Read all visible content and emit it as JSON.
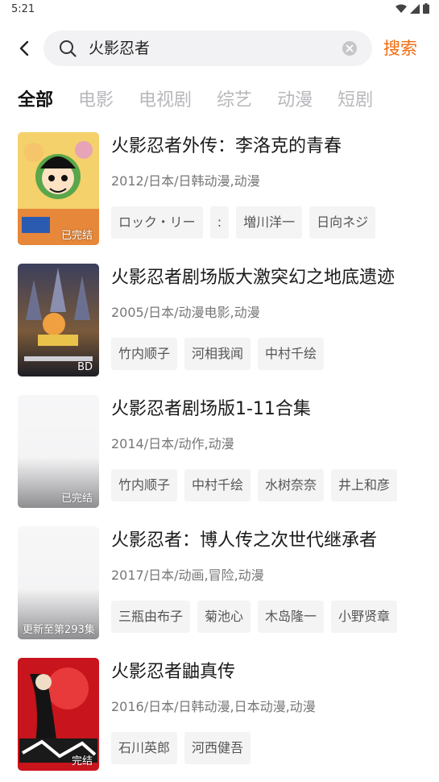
{
  "status": {
    "time": "5:21"
  },
  "search": {
    "query": "火影忍者",
    "button_label": "搜索"
  },
  "tabs": [
    {
      "label": "全部",
      "active": true
    },
    {
      "label": "电影",
      "active": false
    },
    {
      "label": "电视剧",
      "active": false
    },
    {
      "label": "综艺",
      "active": false
    },
    {
      "label": "动漫",
      "active": false
    },
    {
      "label": "短剧",
      "active": false
    }
  ],
  "results": [
    {
      "title": "火影忍者外传：李洛克的青春",
      "meta": "2012/日本/日韩动漫,动漫",
      "badge": "已完结",
      "tags": [
        "ロック・リー",
        ":",
        "増川洋一",
        "日向ネジ"
      ]
    },
    {
      "title": "火影忍者剧场版大激突幻之地底遗迹",
      "meta": "2005/日本/动漫电影,动漫",
      "badge": "BD",
      "tags": [
        "竹内顺子",
        "河相我闻",
        "中村千绘"
      ]
    },
    {
      "title": "火影忍者剧场版1-11合集",
      "meta": "2014/日本/动作,动漫",
      "badge": "已完结",
      "tags": [
        "竹内顺子",
        "中村千绘",
        "水树奈奈",
        "井上和彦"
      ]
    },
    {
      "title": "火影忍者：博人传之次世代继承者",
      "meta": "2017/日本/动画,冒险,动漫",
      "badge": "更新至第293集",
      "tags": [
        "三瓶由布子",
        "菊池心",
        "木岛隆一",
        "小野贤章"
      ]
    },
    {
      "title": "火影忍者鼬真传",
      "meta": "2016/日本/日韩动漫,日本动漫,动漫",
      "badge": "完结",
      "tags": [
        "石川英郎",
        "河西健吾"
      ]
    }
  ],
  "colors": {
    "accent": "#f26b10",
    "tab_inactive": "#b8b8bc",
    "tag_bg": "#f4f4f5"
  }
}
